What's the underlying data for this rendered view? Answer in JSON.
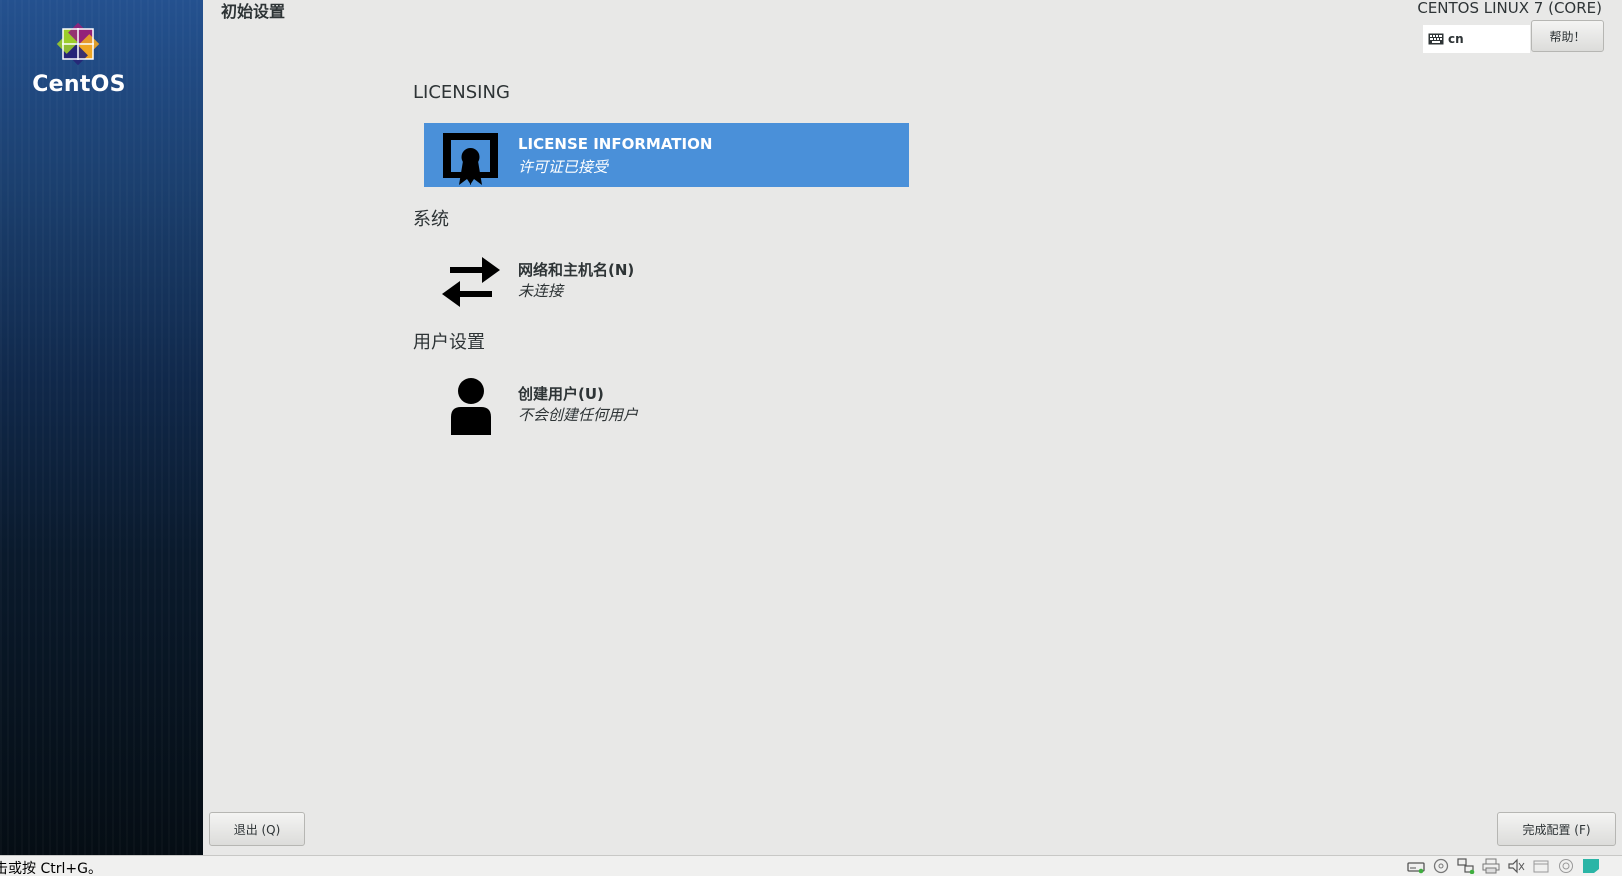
{
  "sidebar": {
    "brand": "CentOS"
  },
  "header": {
    "title": "初始设置",
    "product": "CENTOS LINUX 7 (CORE)",
    "keyboard_layout": "cn",
    "help_label": "帮助！"
  },
  "sections": {
    "licensing": {
      "heading": "LICENSING",
      "spoke": {
        "title": "LICENSE INFORMATION",
        "status": "许可证已接受"
      }
    },
    "system": {
      "heading": "系统",
      "spoke": {
        "title": "网络和主机名(N)",
        "status": "未连接"
      }
    },
    "user": {
      "heading": "用户设置",
      "spoke": {
        "title": "创建用户(U)",
        "status": "不会创建任何用户"
      }
    }
  },
  "footer": {
    "quit_label": "退出 (Q)",
    "finish_label": "完成配置 (F)"
  },
  "statusbar": {
    "hint": "击或按 Ctrl+G。"
  },
  "colors": {
    "selected": "#4a90d9",
    "background": "#e8e8e7"
  }
}
